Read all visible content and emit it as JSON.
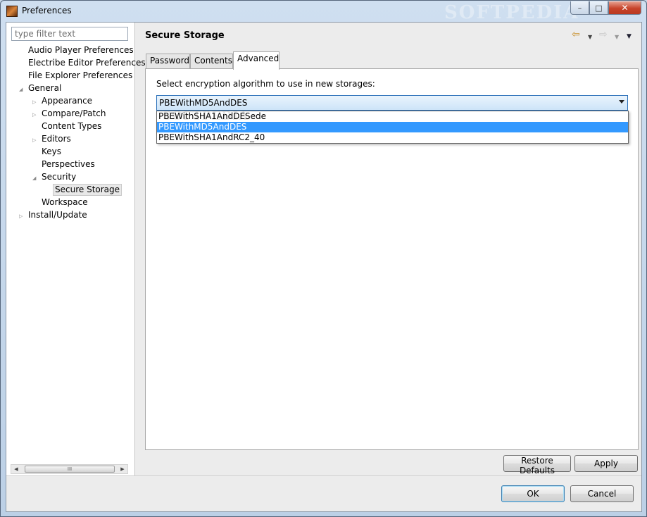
{
  "window": {
    "title": "Preferences",
    "controls": {
      "minimize": "–",
      "maximize": "□",
      "close": "✕"
    },
    "watermark": "SOFTPEDIA"
  },
  "sidebar": {
    "filter_placeholder": "type filter text",
    "items": [
      {
        "label": "Audio Player Preferences"
      },
      {
        "label": "Electribe Editor Preferences"
      },
      {
        "label": "File Explorer Preferences"
      },
      {
        "label": "General",
        "expanded": true
      },
      {
        "label": "Appearance"
      },
      {
        "label": "Compare/Patch"
      },
      {
        "label": "Content Types"
      },
      {
        "label": "Editors"
      },
      {
        "label": "Keys"
      },
      {
        "label": "Perspectives"
      },
      {
        "label": "Security",
        "expanded": true
      },
      {
        "label": "Secure Storage",
        "selected": true
      },
      {
        "label": "Workspace"
      },
      {
        "label": "Install/Update"
      }
    ],
    "scrollbar_grip": "III"
  },
  "page": {
    "title": "Secure Storage",
    "nav_icons": [
      "back-arrow-icon",
      "back-menu-icon",
      "forward-arrow-icon",
      "forward-menu-icon",
      "view-menu-icon"
    ],
    "tabs": [
      {
        "label": "Password"
      },
      {
        "label": "Contents"
      },
      {
        "label": "Advanced",
        "active": true
      }
    ],
    "advanced": {
      "algorithm_label": "Select encryption algorithm to use in new storages:",
      "selected_algorithm": "PBEWithMD5AndDES",
      "options": [
        {
          "label": "PBEWithSHA1AndDESede"
        },
        {
          "label": "PBEWithMD5AndDES",
          "highlighted": true
        },
        {
          "label": "PBEWithSHA1AndRC2_40"
        }
      ]
    },
    "restore_defaults_label": "Restore Defaults",
    "apply_label": "Apply"
  },
  "footer": {
    "ok_label": "OK",
    "cancel_label": "Cancel"
  },
  "colors": {
    "selection": "#3399ff",
    "title_bar": "#cfdff0",
    "close_button": "#c7432a"
  }
}
